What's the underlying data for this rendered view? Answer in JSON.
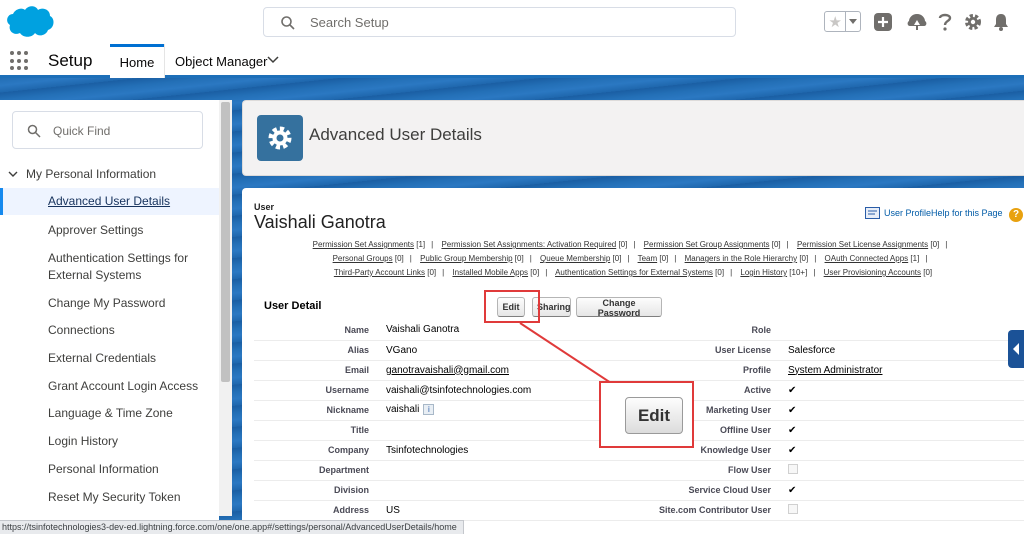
{
  "header": {
    "search_placeholder": "Search Setup"
  },
  "context_bar": {
    "app_name": "Setup",
    "tabs": [
      "Home",
      "Object Manager"
    ]
  },
  "sidebar": {
    "quickfind_placeholder": "Quick Find",
    "section": "My Personal Information",
    "items": [
      "Advanced User Details",
      "Approver Settings",
      "Authentication Settings for External Systems",
      "Change My Password",
      "Connections",
      "External Credentials",
      "Grant Account Login Access",
      "Language & Time Zone",
      "Login History",
      "Personal Information",
      "Reset My Security Token"
    ]
  },
  "page_header": {
    "title": "Advanced User Details"
  },
  "user": {
    "label": "User",
    "name": "Vaishali Ganotra",
    "help_link": "User ProfileHelp for this Page"
  },
  "related_links": [
    [
      {
        "text": "Permission Set Assignments",
        "count": "[1]"
      },
      {
        "text": "Permission Set Assignments: Activation Required",
        "count": "[0]"
      },
      {
        "text": "Permission Set Group Assignments",
        "count": "[0]"
      },
      {
        "text": "Permission Set License Assignments",
        "count": "[0]"
      }
    ],
    [
      {
        "text": "Personal Groups",
        "count": "[0]"
      },
      {
        "text": "Public Group Membership",
        "count": "[0]"
      },
      {
        "text": "Queue Membership",
        "count": "[0]"
      },
      {
        "text": "Team",
        "count": "[0]"
      },
      {
        "text": "Managers in the Role Hierarchy",
        "count": "[0]"
      },
      {
        "text": "OAuth Connected Apps",
        "count": "[1]"
      }
    ],
    [
      {
        "text": "Third-Party Account Links",
        "count": "[0]"
      },
      {
        "text": "Installed Mobile Apps",
        "count": "[0]"
      },
      {
        "text": "Authentication Settings for External Systems",
        "count": "[0]"
      },
      {
        "text": "Login History",
        "count": "[10+]"
      },
      {
        "text": "User Provisioning Accounts",
        "count": "[0]"
      }
    ]
  ],
  "user_detail": {
    "title": "User Detail",
    "buttons": {
      "edit": "Edit",
      "sharing": "Sharing",
      "change_password": "Change Password"
    },
    "rows": [
      {
        "l1": "Name",
        "v1": "Vaishali Ganotra",
        "l2": "Role",
        "v2": ""
      },
      {
        "l1": "Alias",
        "v1": "VGano",
        "l2": "User License",
        "v2": "Salesforce"
      },
      {
        "l1": "Email",
        "v1": "ganotravaishali@gmail.com",
        "l2": "Profile",
        "v2": "System Administrator"
      },
      {
        "l1": "Username",
        "v1": "vaishali@tsinfotechnologies.com",
        "l2": "Active",
        "v2": "✔"
      },
      {
        "l1": "Nickname",
        "v1": "vaishali",
        "l2": "Marketing User",
        "v2": "✔"
      },
      {
        "l1": "Title",
        "v1": "",
        "l2": "Offline User",
        "v2": "✔"
      },
      {
        "l1": "Company",
        "v1": "Tsinfotechnologies",
        "l2": "Knowledge User",
        "v2": "✔"
      },
      {
        "l1": "Department",
        "v1": "",
        "l2": "Flow User",
        "v2": ""
      },
      {
        "l1": "Division",
        "v1": "",
        "l2": "Service Cloud User",
        "v2": "✔"
      },
      {
        "l1": "Address",
        "v1": "US",
        "l2": "Site.com Contributor User",
        "v2": ""
      }
    ],
    "nickname_info": "i"
  },
  "annotation": {
    "zoom_label": "Edit"
  },
  "status_bar": {
    "url": "https://tsinfotechnologies3-dev-ed.lightning.force.com/one/one.app#/settings/personal/AdvancedUserDetails/home"
  },
  "colors": {
    "brand_blue": "#0070d2",
    "highlight_red": "#e03a3a",
    "page_icon": "#35719e"
  }
}
